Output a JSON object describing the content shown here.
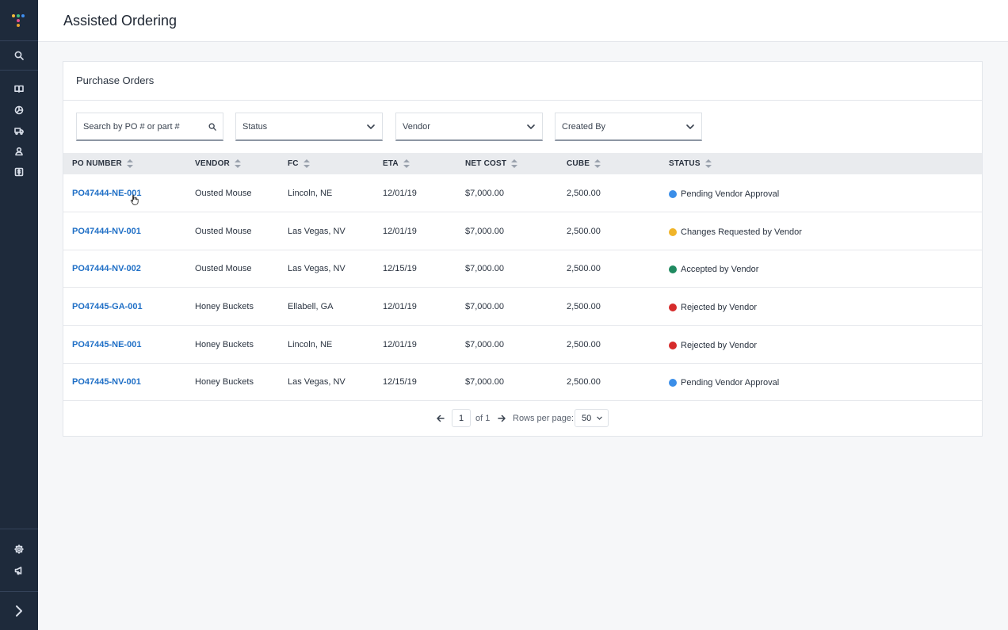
{
  "app": {
    "title": "Assisted Ordering"
  },
  "sidebar": {
    "logo_colors": [
      "#f5b93b",
      "#3fbf7f",
      "#3f8ff0",
      "#e44d8d",
      "#e6a02e"
    ],
    "top_items": [
      {
        "icon": "search-icon"
      },
      {
        "icon": "book-icon"
      },
      {
        "icon": "chart-pie-icon"
      },
      {
        "icon": "truck-icon"
      },
      {
        "icon": "user-icon"
      },
      {
        "icon": "dollar-icon"
      }
    ],
    "bottom_items": [
      {
        "icon": "gear-icon"
      },
      {
        "icon": "megaphone-icon"
      }
    ],
    "expand_icon": "chevron-right-icon"
  },
  "card": {
    "title": "Purchase Orders"
  },
  "filters": {
    "search_placeholder": "Search by PO # or part #",
    "status_label": "Status",
    "vendor_label": "Vendor",
    "created_by_label": "Created By"
  },
  "table": {
    "columns": [
      "PO NUMBER",
      "VENDOR",
      "FC",
      "ETA",
      "NET COST",
      "CUBE",
      "STATUS"
    ],
    "rows": [
      {
        "po": "PO47444-NE-001",
        "vendor": "Ousted Mouse",
        "fc": "Lincoln, NE",
        "eta": "12/01/19",
        "net_cost": "$7,000.00",
        "cube": "2,500.00",
        "status": "Pending Vendor Approval",
        "status_color": "#3b8ee8"
      },
      {
        "po": "PO47444-NV-001",
        "vendor": "Ousted Mouse",
        "fc": "Las Vegas, NV",
        "eta": "12/01/19",
        "net_cost": "$7,000.00",
        "cube": "2,500.00",
        "status": "Changes Requested by Vendor",
        "status_color": "#f0b429"
      },
      {
        "po": "PO47444-NV-002",
        "vendor": "Ousted Mouse",
        "fc": "Las Vegas, NV",
        "eta": "12/15/19",
        "net_cost": "$7,000.00",
        "cube": "2,500.00",
        "status": "Accepted by Vendor",
        "status_color": "#1f8a60"
      },
      {
        "po": "PO47445-GA-001",
        "vendor": "Honey Buckets",
        "fc": "Ellabell, GA",
        "eta": "12/01/19",
        "net_cost": "$7,000.00",
        "cube": "2,500.00",
        "status": "Rejected by Vendor",
        "status_color": "#d62b2b"
      },
      {
        "po": "PO47445-NE-001",
        "vendor": "Honey Buckets",
        "fc": "Lincoln, NE",
        "eta": "12/01/19",
        "net_cost": "$7,000.00",
        "cube": "2,500.00",
        "status": "Rejected by Vendor",
        "status_color": "#d62b2b"
      },
      {
        "po": "PO47445-NV-001",
        "vendor": "Honey Buckets",
        "fc": "Las Vegas, NV",
        "eta": "12/15/19",
        "net_cost": "$7,000.00",
        "cube": "2,500.00",
        "status": "Pending Vendor Approval",
        "status_color": "#3b8ee8"
      }
    ]
  },
  "pagination": {
    "page": "1",
    "of_text": "of 1",
    "rows_label": "Rows per page:",
    "rows_value": "50"
  }
}
